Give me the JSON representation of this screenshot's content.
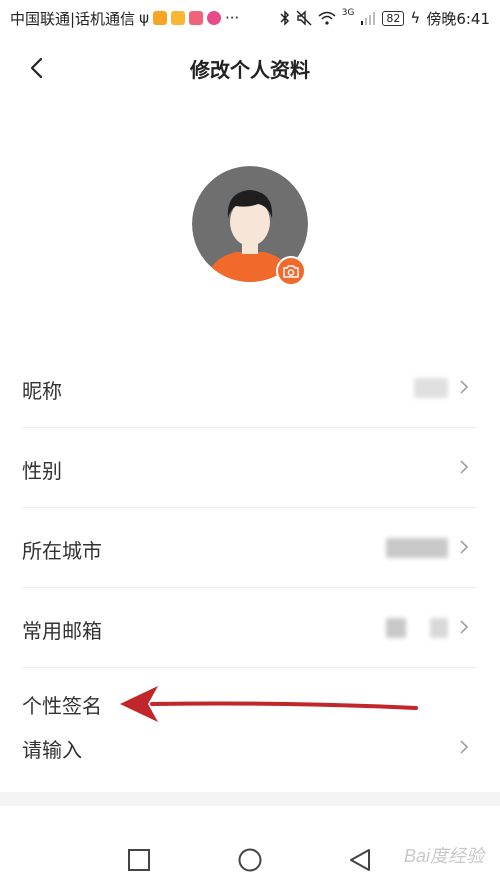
{
  "status_bar": {
    "carrier": "中国联通|话机通信",
    "more": "···",
    "network": "3G",
    "battery": "82",
    "time": "傍晚6:41"
  },
  "header": {
    "title": "修改个人资料"
  },
  "profile_rows": [
    {
      "label": "昵称"
    },
    {
      "label": "性别"
    },
    {
      "label": "所在城市"
    },
    {
      "label": "常用邮箱"
    }
  ],
  "signature": {
    "label": "个性签名",
    "placeholder": "请输入"
  },
  "watermark": "Bai度经验",
  "colors": {
    "accent": "#f26a2b",
    "annotation_arrow": "#c0262a",
    "divider": "#ececec"
  }
}
